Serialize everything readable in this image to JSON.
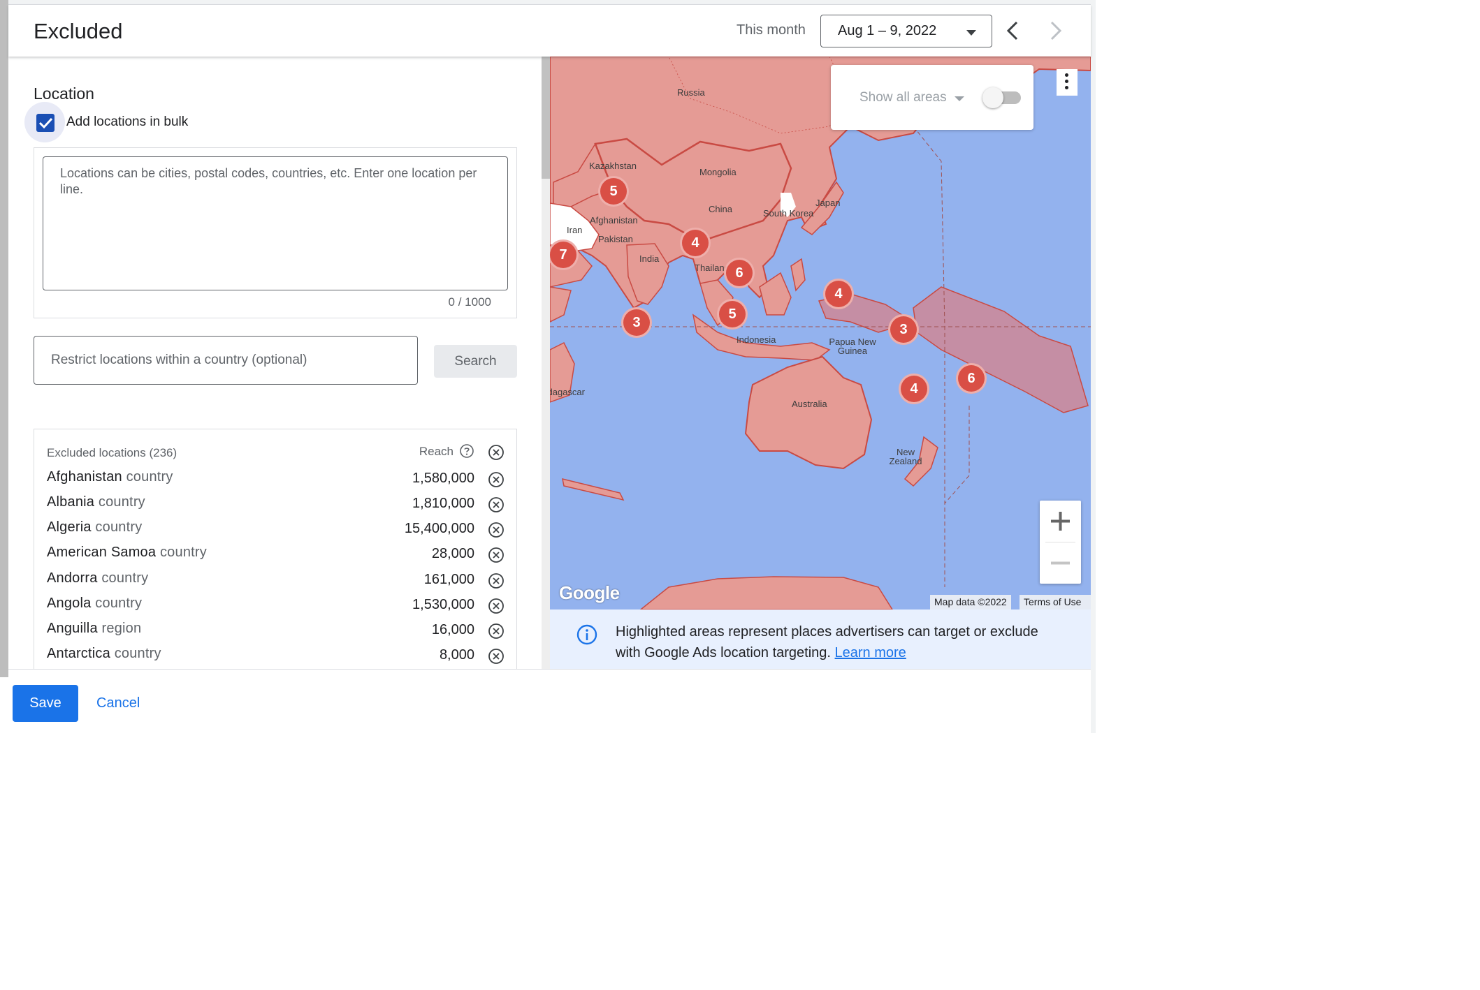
{
  "header": {
    "title": "Excluded",
    "period_label": "This month",
    "date_range": "Aug 1 – 9, 2022"
  },
  "location_section": {
    "title": "Location",
    "bulk_checkbox": {
      "label": "Add locations in bulk",
      "checked": true
    },
    "bulk_placeholder": "Locations can be cities, postal codes, countries, etc. Enter one location per line.",
    "bulk_count": "0 / 1000",
    "restrict_placeholder": "Restrict locations within a country (optional)",
    "search_label": "Search"
  },
  "excluded_list": {
    "header": "Excluded locations (236)",
    "reach_label": "Reach",
    "rows": [
      {
        "name": "Afghanistan",
        "kind": "country",
        "reach": "1,580,000"
      },
      {
        "name": "Albania",
        "kind": "country",
        "reach": "1,810,000"
      },
      {
        "name": "Algeria",
        "kind": "country",
        "reach": "15,400,000"
      },
      {
        "name": "American Samoa",
        "kind": "country",
        "reach": "28,000"
      },
      {
        "name": "Andorra",
        "kind": "country",
        "reach": "161,000"
      },
      {
        "name": "Angola",
        "kind": "country",
        "reach": "1,530,000"
      },
      {
        "name": "Anguilla",
        "kind": "region",
        "reach": "16,000"
      },
      {
        "name": "Antarctica",
        "kind": "country",
        "reach": "8,000"
      }
    ]
  },
  "map": {
    "show_areas_label": "Show all areas",
    "show_areas_toggle": false,
    "country_labels": [
      "Russia",
      "Kazakhstan",
      "Mongolia",
      "China",
      "South Korea",
      "Japan",
      "Iran",
      "Afghanistan",
      "Pakistan",
      "India",
      "Thailand",
      "Indonesia",
      "Papua New Guinea",
      "Australia",
      "New Zealand",
      "Madagascar"
    ],
    "clusters": [
      "5",
      "4",
      "6",
      "7",
      "3",
      "5",
      "4",
      "3",
      "4",
      "6"
    ],
    "logo_text": "Google",
    "attribution": "Map data ©2022",
    "terms": "Terms of Use",
    "colors": {
      "ocean": "#93b2ee",
      "highlight": "#e59b95",
      "border": "#c94a43",
      "cluster": "#d94f45"
    }
  },
  "info": {
    "text": "Highlighted areas represent places advertisers can target or exclude with Google Ads location targeting.",
    "link": "Learn more"
  },
  "footer": {
    "save_label": "Save",
    "cancel_label": "Cancel"
  }
}
